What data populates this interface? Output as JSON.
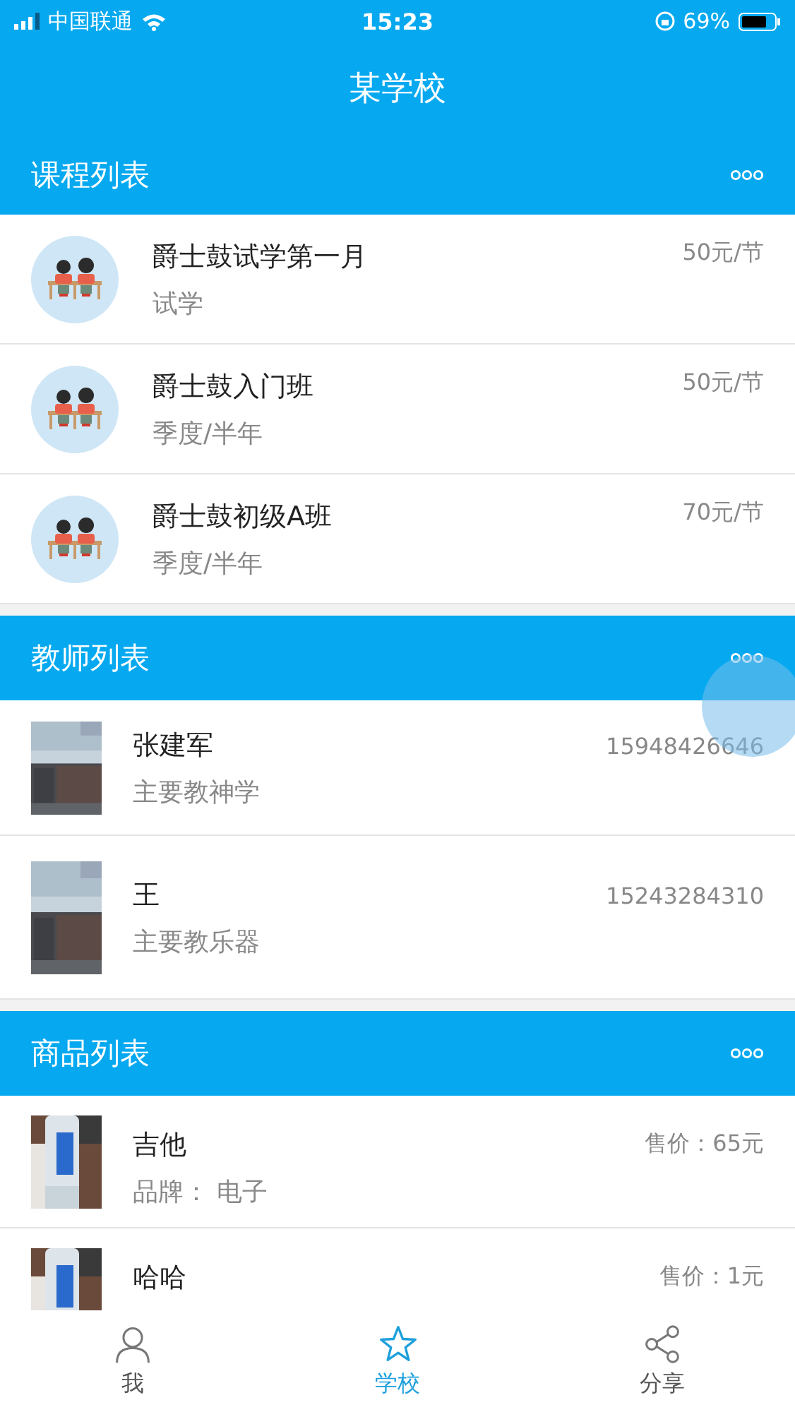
{
  "status_bar": {
    "carrier": "中国联通",
    "time": "15:23",
    "battery": "69%"
  },
  "title": "某学校",
  "sections": [
    {
      "kind": "course",
      "title": "课程列表",
      "items": [
        {
          "name": "爵士鼓试学第一月",
          "subtitle": "试学",
          "price": "50元/节"
        },
        {
          "name": "爵士鼓入门班",
          "subtitle": "季度/半年",
          "price": "50元/节"
        },
        {
          "name": "爵士鼓初级A班",
          "subtitle": "季度/半年",
          "price": "70元/节"
        }
      ]
    },
    {
      "kind": "teacher",
      "title": "教师列表",
      "items": [
        {
          "name": "张建军",
          "subtitle": "主要教神学",
          "price": "15948426646"
        },
        {
          "name": "王",
          "subtitle": "主要教乐器",
          "price": "15243284310"
        }
      ]
    },
    {
      "kind": "product",
      "title": "商品列表",
      "items": [
        {
          "name": "吉他",
          "subtitle": "品牌：  电子",
          "price": "售价：65元"
        },
        {
          "name": "哈哈",
          "price": "售价：1元"
        }
      ]
    }
  ],
  "tabs": [
    {
      "label": "我",
      "selected": false
    },
    {
      "label": "学校",
      "selected": true
    },
    {
      "label": "分享",
      "selected": false
    }
  ]
}
